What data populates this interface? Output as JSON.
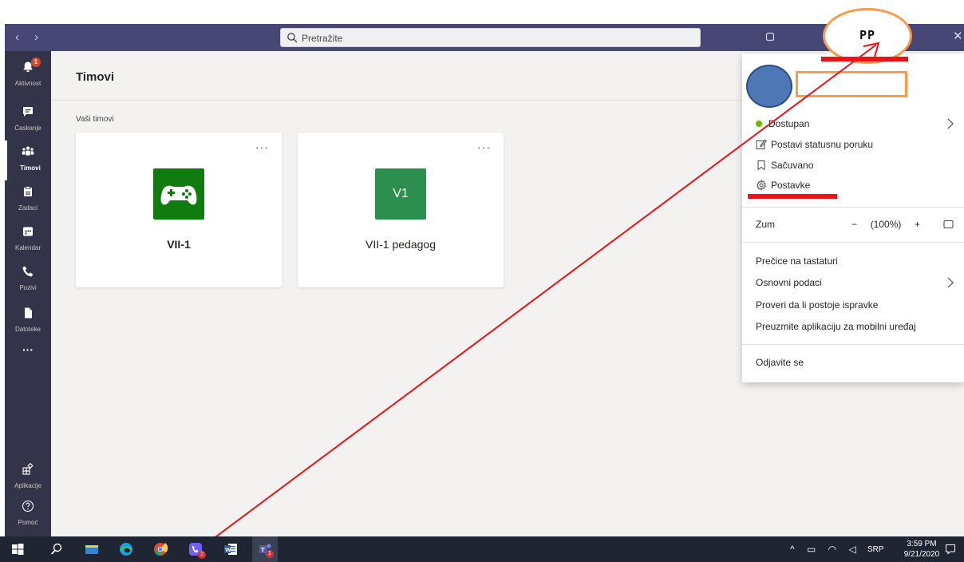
{
  "titlebar": {
    "back": "‹",
    "forward": "›",
    "search_placeholder": "Pretražite",
    "close": "✕"
  },
  "rail": {
    "items": [
      {
        "label": "Aktivnost",
        "icon": "bell-icon",
        "badge": "1"
      },
      {
        "label": "Ćaskanje",
        "icon": "chat-icon"
      },
      {
        "label": "Timovi",
        "icon": "teams-icon",
        "active": true
      },
      {
        "label": "Zadaci",
        "icon": "assignments-icon"
      },
      {
        "label": "Kalendar",
        "icon": "calendar-icon"
      },
      {
        "label": "Pozivi",
        "icon": "phone-icon"
      },
      {
        "label": "Datoteke",
        "icon": "file-icon"
      }
    ],
    "more": "···",
    "apps_label": "Aplikacije",
    "help_label": "Pomoć"
  },
  "main": {
    "title": "Timovi",
    "section_label": "Vaši timovi",
    "teams": [
      {
        "name": "VII-1",
        "bold": true,
        "avatar_type": "gamepad",
        "color": "#107c10",
        "more": "···"
      },
      {
        "name": "VII-1 pedagog",
        "bold": false,
        "avatar_text": "V1",
        "color": "#2d8f4e",
        "more": "···"
      }
    ]
  },
  "profile_menu": {
    "status": "Dostupan",
    "set_status": "Postavi statusnu poruku",
    "saved": "Sačuvano",
    "settings": "Postavke",
    "zoom_label": "Zum",
    "zoom_minus": "−",
    "zoom_value": "(100%)",
    "zoom_plus": "+",
    "shortcuts": "Prečice na tastaturi",
    "about": "Osnovni podaci",
    "check_updates": "Proveri da li postoje ispravke",
    "mobile_app": "Preuzmite aplikaciju za mobilni uređaj",
    "sign_out": "Odjavite se"
  },
  "annotation": {
    "pp_label": "PP",
    "highlight_color": "#f79b4c",
    "arrow_color": "#e8141a"
  },
  "taskbar": {
    "teams_badge": "1",
    "viber_badge": "2",
    "language": "SRP",
    "time": "3:59 PM",
    "date": "9/21/2020"
  },
  "colors": {
    "teams_purple": "#464775",
    "rail": "#33344a",
    "status_available": "#6bb700"
  }
}
